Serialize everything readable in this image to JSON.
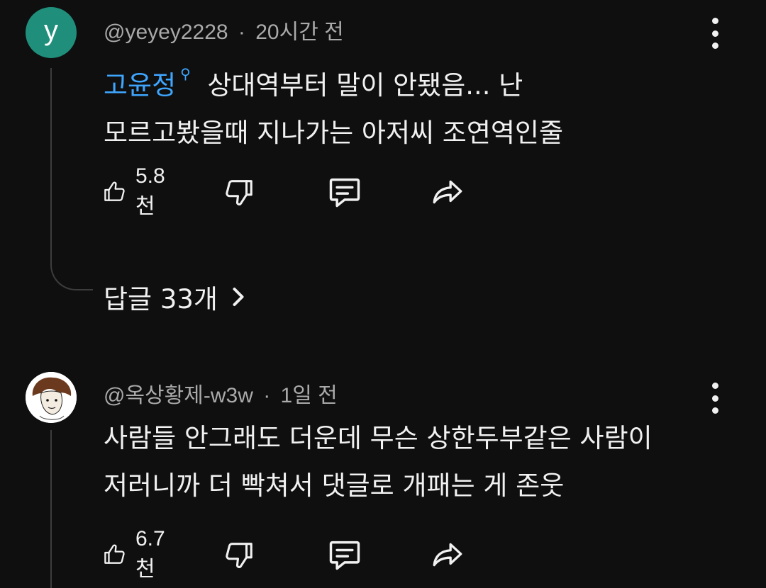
{
  "comments": [
    {
      "avatar_letter": "y",
      "author": "@yeyey2228",
      "separator": "·",
      "time": "20시간 전",
      "mention": "고윤정",
      "line1": "상대역부터 말이 안됐음... 난",
      "line2": "모르고봤을때 지나가는 아저씨 조연역인줄",
      "likes": "5.8천",
      "replies_label": "답글 33개"
    },
    {
      "author": "@옥상황제-w3w",
      "separator": "·",
      "time": "1일 전",
      "line1": "사람들 안그래도 더운데 무슨 상한두부같은 사람이",
      "line2": "저러니까 더 빡쳐서 댓글로 개패는 게 존웃",
      "likes": "6.7천"
    }
  ],
  "colors": {
    "background": "#0f0f0f",
    "text": "#f1f1f1",
    "meta": "#aaaaaa",
    "mention": "#3ea6ff",
    "avatar_bg": "#1f8f7b"
  }
}
